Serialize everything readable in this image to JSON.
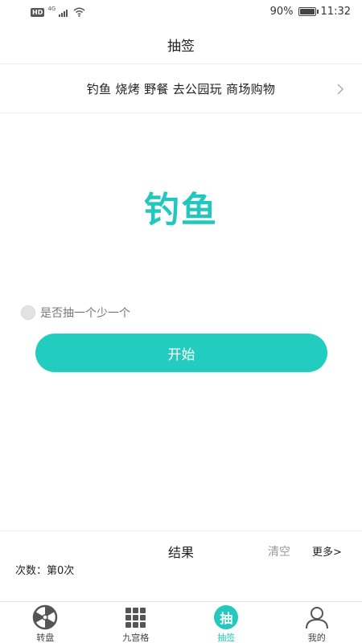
{
  "status_bar": {
    "hd": "HD",
    "network": "4G",
    "battery_text": "90%",
    "battery_level": 0.9,
    "time": "11:32"
  },
  "title": "抽签",
  "options_text": "钓鱼 烧烤 野餐 去公园玩 商场购物",
  "drawn_result": "钓鱼",
  "toggle_label": "是否抽一个少一个",
  "start_label": "开始",
  "results": {
    "title": "结果",
    "clear": "清空",
    "more": "更多>",
    "count_text": "次数：第0次"
  },
  "nav": [
    {
      "label": "转盘",
      "icon": "wheel-icon"
    },
    {
      "label": "九宫格",
      "icon": "grid-icon"
    },
    {
      "label": "抽签",
      "icon": "draw-lots-icon",
      "glyph": "抽"
    },
    {
      "label": "我的",
      "icon": "user-icon"
    }
  ],
  "colors": {
    "accent": "#22cdc0",
    "result_text": "#23c7bd"
  }
}
